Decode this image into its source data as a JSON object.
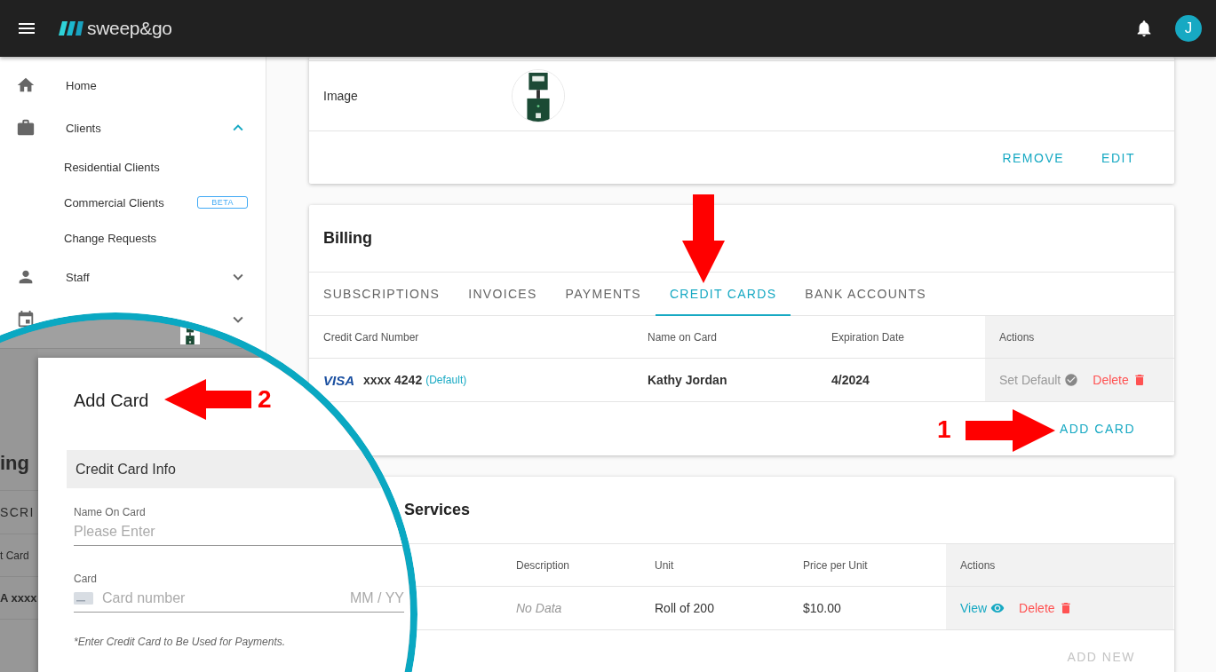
{
  "app_bar": {
    "logo": "sweep&go",
    "avatar": "J"
  },
  "sidebar": {
    "items": [
      {
        "label": "Home"
      },
      {
        "label": "Clients",
        "expanded": true,
        "children": [
          {
            "label": "Residential Clients"
          },
          {
            "label": "Commercial Clients",
            "badge": "BETA"
          },
          {
            "label": "Change Requests"
          }
        ]
      },
      {
        "label": "Staff",
        "expanded": false
      },
      {
        "expanded": false
      }
    ]
  },
  "product_card": {
    "rows": [
      {
        "label": "Image",
        "kind": "picture"
      }
    ],
    "actions": [
      "REMOVE",
      "EDIT"
    ]
  },
  "billing": {
    "title": "Billing",
    "tabs": [
      {
        "label": "SUBSCRIPTIONS",
        "selected": false
      },
      {
        "label": "INVOICES",
        "selected": false
      },
      {
        "label": "PAYMENTS",
        "selected": false
      },
      {
        "label": "CREDIT CARDS",
        "selected": true
      },
      {
        "label": "BANK ACCOUNTS",
        "selected": false
      }
    ],
    "table": {
      "columns": [
        "Credit Card Number",
        "Name on Card",
        "Expiration Date",
        "Actions"
      ],
      "rows": [
        {
          "brand": "VISA",
          "card_number": "xxxx 4242",
          "default_tag": "(Default)",
          "name": "Kathy Jordan",
          "expiration": "4/2024",
          "actions": [
            {
              "label": "Set Default",
              "kind": "set_default"
            },
            {
              "label": "Delete",
              "kind": "delete"
            }
          ]
        }
      ]
    },
    "footer_button": "ADD CARD"
  },
  "services": {
    "title": "Services",
    "table": {
      "columns": [
        "Description",
        "Unit",
        "Price per Unit",
        "Actions"
      ],
      "rows": [
        {
          "description": "No Data",
          "unit": "Roll of 200",
          "price": "$10.00",
          "actions": [
            {
              "label": "View",
              "kind": "view"
            },
            {
              "label": "Delete",
              "kind": "delete"
            }
          ]
        }
      ]
    },
    "footer_button": {
      "label": "ADD NEW",
      "disabled": true
    }
  },
  "annotations": [
    {
      "label": "1"
    },
    {
      "label": "2"
    }
  ],
  "magnifier": {
    "background_texts": [
      "ing",
      "SCRI",
      "t Card",
      "A xxxx"
    ],
    "dialog": {
      "title": "Add Card",
      "section": "Credit Card Info",
      "fields": [
        {
          "label": "Name On Card",
          "placeholder": "Please Enter"
        },
        {
          "label": "Card",
          "placeholder": "Card number",
          "expiry_placeholder": "MM / YY"
        }
      ],
      "note": "*Enter Credit Card to Be Used for Payments."
    }
  }
}
